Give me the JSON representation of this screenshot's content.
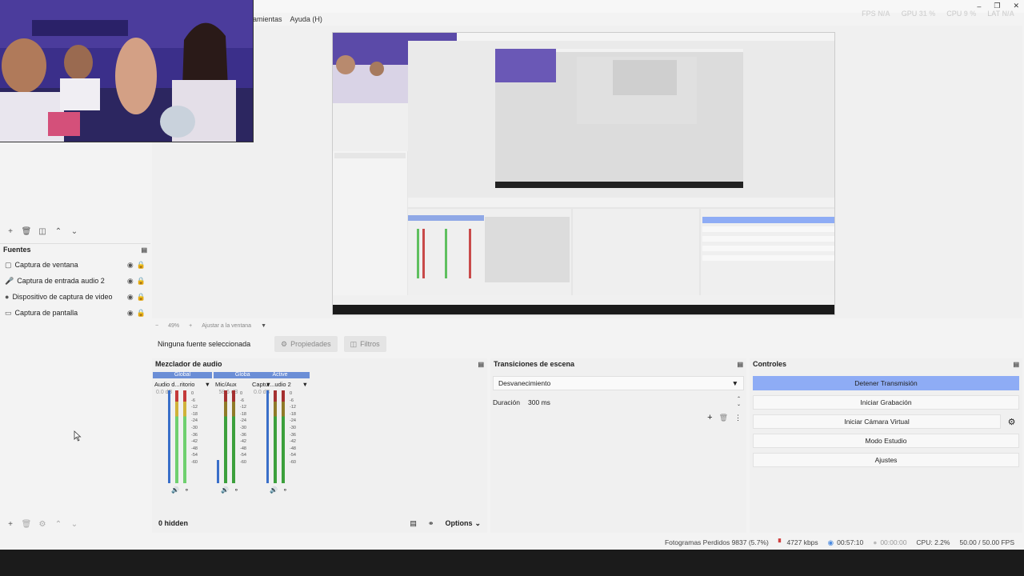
{
  "menu": [
    "amientas",
    "Ayuda (H)"
  ],
  "stats": {
    "fps_label": "FPS",
    "fps": "N/A",
    "gpu_label": "GPU",
    "gpu": "31 %",
    "cpu_label": "CPU",
    "cpu": "9 %",
    "lat_label": "LAT",
    "lat": "N/A"
  },
  "sources": {
    "title": "Fuentes",
    "items": [
      {
        "icon": "window-icon",
        "name": "Captura de ventana"
      },
      {
        "icon": "microphone-icon",
        "name": "Captura de entrada audio 2"
      },
      {
        "icon": "camera-icon",
        "name": "Dispositivo de captura de video"
      },
      {
        "icon": "monitor-icon",
        "name": "Captura de pantalla"
      }
    ]
  },
  "preview": {
    "zoom_minus": "−",
    "zoom": "49%",
    "zoom_plus": "+",
    "fit": "Ajustar a la ventana",
    "no_source": "Ninguna fuente seleccionada",
    "properties": "Propiedades",
    "filters": "Filtros"
  },
  "mixer": {
    "title": "Mezclador de audio",
    "channels": [
      {
        "mode": "Global",
        "name": "Audio d...ritorio",
        "db": "0.0 dB"
      },
      {
        "mode": "Global",
        "name": "Mic/Aux",
        "db": "-58.6 dB"
      },
      {
        "mode": "Active",
        "name": "Captur...udio 2",
        "db": "0.0 dB"
      }
    ],
    "scale": [
      "0",
      "-6",
      "-12",
      "-18",
      "-24",
      "-30",
      "-36",
      "-42",
      "-48",
      "-54",
      "-60"
    ],
    "hidden": "0 hidden",
    "options": "Options"
  },
  "transitions": {
    "title": "Transiciones de escena",
    "selected": "Desvanecimiento",
    "duration_label": "Duración",
    "duration": "300 ms"
  },
  "controls": {
    "title": "Controles",
    "stop_stream": "Detener Transmisión",
    "start_record": "Iniciar Grabación",
    "virtual_cam": "Iniciar Cámara Virtual",
    "studio": "Modo Estudio",
    "settings": "Ajustes",
    "accent": "#8eacf5"
  },
  "status": {
    "dropped": "Fotogramas Perdidos 9837 (5.7%)",
    "bitrate": "4727 kbps",
    "stream_time": "00:57:10",
    "record_time": "00:00:00",
    "cpu": "CPU: 2.2%",
    "fps": "50.00 / 50.00 FPS"
  }
}
